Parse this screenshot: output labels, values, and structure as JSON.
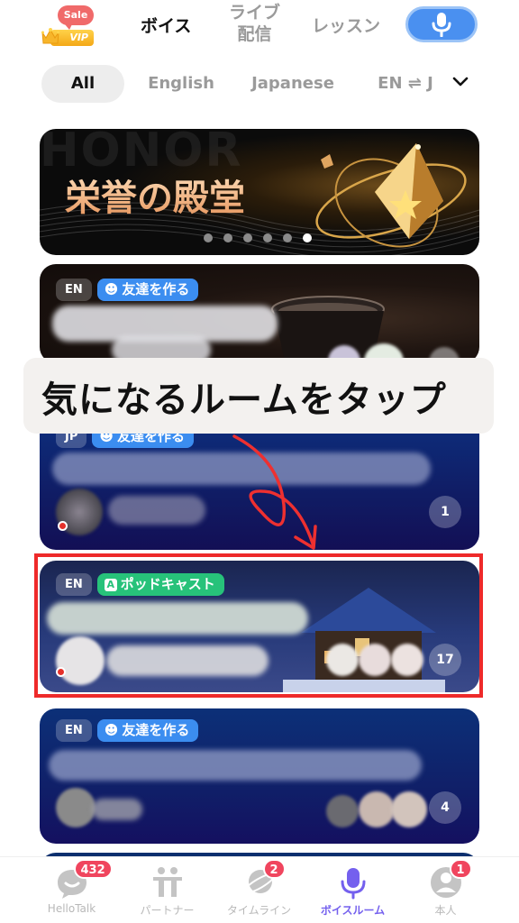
{
  "header": {
    "vip": {
      "sale_label": "Sale",
      "vip_label": "VIP"
    },
    "tabs": [
      {
        "label": "ボイス",
        "active": true
      },
      {
        "label": "ライブ配信",
        "line1": "ライブ",
        "line2": "配信",
        "active": false
      },
      {
        "label": "レッスン",
        "active": false
      }
    ],
    "mic_button": {
      "icon": "microphone-icon",
      "color": "#4a90f0"
    }
  },
  "filters": {
    "chips": [
      {
        "label": "All",
        "active": true
      },
      {
        "label": "English",
        "active": false
      },
      {
        "label": "Japanese",
        "active": false
      },
      {
        "label": "EN ⇌ J",
        "active": false
      }
    ],
    "expand_icon": "chevron-down-icon"
  },
  "banner": {
    "ghost_text": "HONOR",
    "title": "栄誉の殿堂",
    "dots_total": 6,
    "active_dot": 6
  },
  "overlay_caption": "気になるルームをタップ",
  "rooms": [
    {
      "lang": "EN",
      "type_label": "友達を作る",
      "type": "friend",
      "count": ""
    },
    {
      "lang": "JP",
      "type_label": "友達を作る",
      "type": "friend",
      "count": "1"
    },
    {
      "lang": "EN",
      "type_label": "ポッドキャスト",
      "type": "podcast",
      "count": "17",
      "highlighted": true
    },
    {
      "lang": "EN",
      "type_label": "友達を作る",
      "type": "friend",
      "count": "4"
    }
  ],
  "colors": {
    "accent_nav": "#7460ee",
    "highlight": "#ee2a2a",
    "friend_tag": "#3b8df0",
    "podcast_tag": "#27c27a",
    "badge": "#f0455e"
  },
  "bottom_nav": [
    {
      "label": "HelloTalk",
      "icon": "chat-bubble-icon",
      "badge": "432",
      "active": false
    },
    {
      "label": "パートナー",
      "icon": "partners-icon",
      "badge": "",
      "active": false
    },
    {
      "label": "タイムライン",
      "icon": "planet-icon",
      "badge": "2",
      "active": false
    },
    {
      "label": "ボイスルーム",
      "icon": "microphone-icon",
      "badge": "",
      "active": true
    },
    {
      "label": "本人",
      "icon": "profile-icon",
      "badge": "1",
      "active": false
    }
  ]
}
